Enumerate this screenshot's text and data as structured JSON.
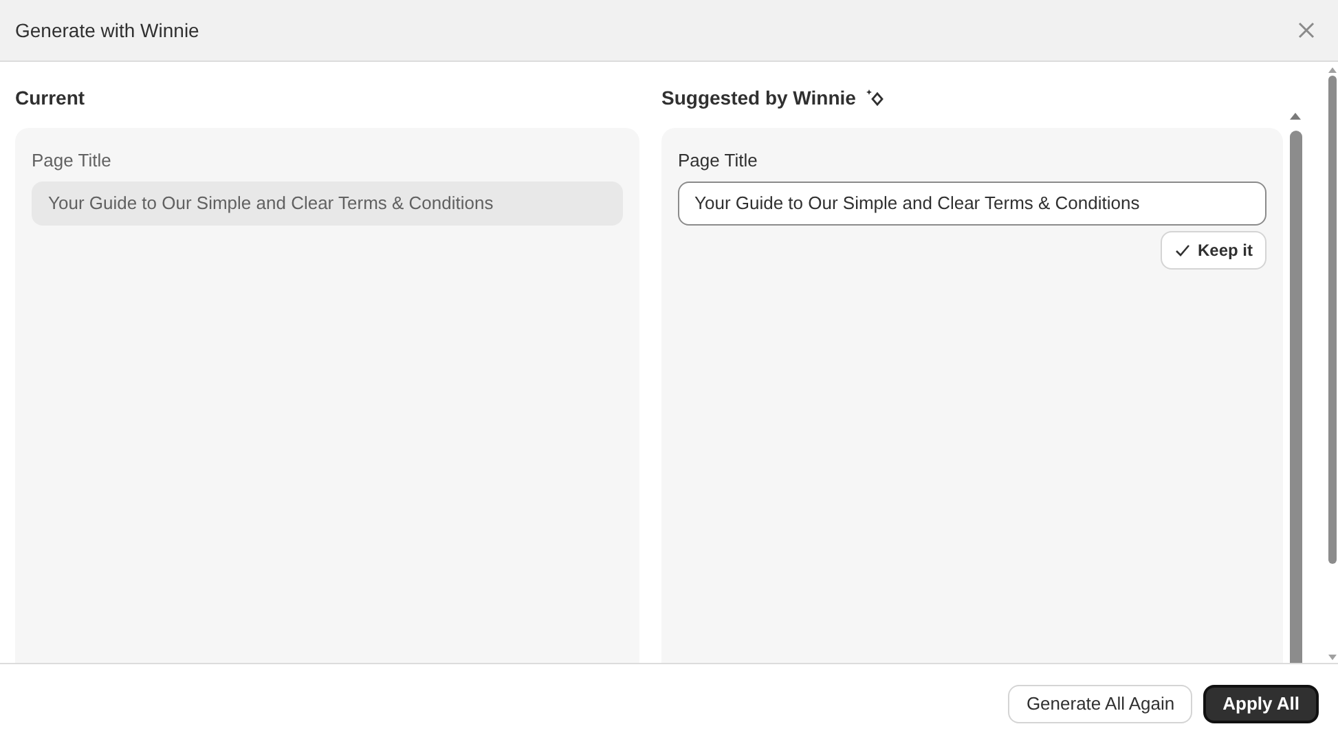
{
  "dialog": {
    "title": "Generate with Winnie"
  },
  "current": {
    "heading": "Current",
    "field_label": "Page Title",
    "value": "Your Guide to Our Simple and Clear Terms & Conditions"
  },
  "suggested": {
    "heading": "Suggested by Winnie",
    "field_label": "Page Title",
    "value": "Your Guide to Our Simple and Clear Terms & Conditions",
    "keep_button": "Keep it"
  },
  "footer": {
    "buttons": [
      {
        "label": "Generate All Again",
        "kind": "secondary"
      },
      {
        "label": "Apply All",
        "kind": "primary"
      }
    ]
  }
}
